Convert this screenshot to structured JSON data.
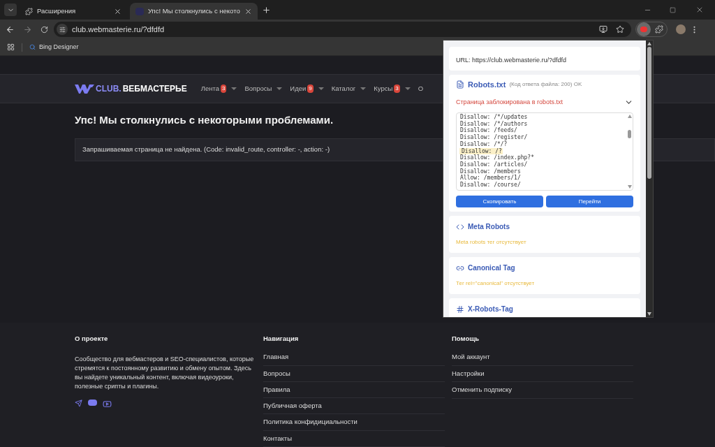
{
  "browser": {
    "tabs": [
      {
        "title": "Расширения",
        "selected": false
      },
      {
        "title": "Упс! Мы столкнулись с некото",
        "selected": true
      }
    ],
    "url": "club.webmasterie.ru/?dfdfd",
    "bookmarks": [
      "Bing Designer"
    ]
  },
  "site": {
    "logo": {
      "part_1": "CLUB.",
      "part_2": "ВЕБМАСТЕРЬЕ"
    },
    "nav": [
      {
        "label": "Лента",
        "badge": "3",
        "dropdown": true
      },
      {
        "label": "Вопросы",
        "dropdown": true
      },
      {
        "label": "Идеи",
        "badge": "9",
        "dropdown": true
      },
      {
        "label": "Каталог",
        "dropdown": true
      },
      {
        "label": "Курсы",
        "badge": "3",
        "dropdown": true
      },
      {
        "label": "О",
        "dropdown": false
      }
    ],
    "error": {
      "title": "Упс! Мы столкнулись с некоторыми проблемами.",
      "message": "Запрашиваемая страница не найдена. (Code: invalid_route, controller: -, action: -)"
    },
    "footer": {
      "about": {
        "title": "О проекте",
        "text": "Сообщество для вебмастеров и SEO-специалистов, которые стремятся к постоянному развитию и обмену опытом. Здесь вы найдете уникальный контент, включая видеоуроки, полезные срипты и плагины."
      },
      "link_columns": [
        {
          "title": "Навигация",
          "links": [
            "Главная",
            "Вопросы",
            "Правила",
            "Публичная оферта",
            "Политика конфидициальности",
            "Контакты"
          ]
        },
        {
          "title": "Помощь",
          "links": [
            "Мой аккаунт",
            "Настройки",
            "Отменить подписку"
          ]
        }
      ]
    }
  },
  "popup": {
    "url_line": "URL: https://club.webmasterie.ru/?dfdfd",
    "robots": {
      "title": "Robots.txt",
      "status": "(Код ответа файла: 200) OK",
      "alert": "Страница заблокирована в robots.txt",
      "expanded": true,
      "lines": [
        {
          "text": "Disallow: /*/updates",
          "highlighted": false
        },
        {
          "text": "Disallow: /*/authors",
          "highlighted": false
        },
        {
          "text": "Disallow: /feeds/",
          "highlighted": false
        },
        {
          "text": "Disallow: /register/",
          "highlighted": false
        },
        {
          "text": "Disallow: /*/?",
          "highlighted": false
        },
        {
          "text": "Disallow: /?",
          "highlighted": true
        },
        {
          "text": "Disallow: /index.php?*",
          "highlighted": false
        },
        {
          "text": "Disallow: /articles/",
          "highlighted": false
        },
        {
          "text": "Disallow: /members",
          "highlighted": false
        },
        {
          "text": "Allow: /members/1/",
          "highlighted": false
        },
        {
          "text": "Disallow: /course/",
          "highlighted": false
        }
      ],
      "buttons": [
        "Скопировать",
        "Перейти"
      ]
    },
    "sections": [
      {
        "kind": "code",
        "title": "Meta Robots",
        "note": "Meta robots тег отсутствует"
      },
      {
        "kind": "link",
        "title": "Canonical Tag",
        "note": "Тег rel=\"canonical\" отсутствует"
      },
      {
        "kind": "hash",
        "title": "X-Robots-Tag"
      }
    ]
  }
}
